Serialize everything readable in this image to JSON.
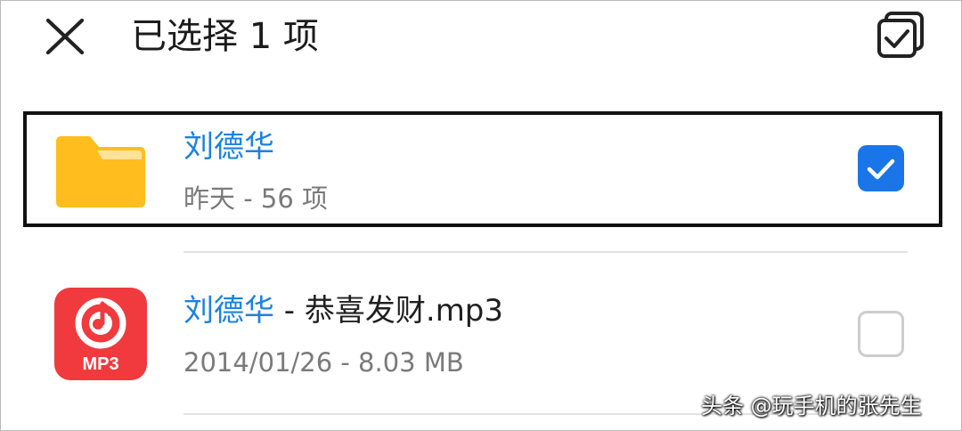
{
  "header": {
    "close_icon": "close-icon",
    "title": "已选择 1 项",
    "select_all_icon": "select-all-icon"
  },
  "items": [
    {
      "type": "folder",
      "icon": "folder-icon",
      "name_highlight": "刘德华",
      "name_rest": "",
      "meta": "昨天 - 56 项",
      "checked": true,
      "icon_color": "#FFBE1E"
    },
    {
      "type": "audio",
      "icon": "mp3-file-icon",
      "icon_label": "MP3",
      "name_highlight": "刘德华",
      "name_rest": " - 恭喜发财.mp3",
      "meta": "2014/01/26 - 8.03 MB",
      "checked": false,
      "icon_color": "#F03A3E"
    }
  ],
  "colors": {
    "accent": "#1A76E8",
    "highlight_text": "#1A82E2"
  },
  "watermark": "头条 @玩手机的张先生"
}
